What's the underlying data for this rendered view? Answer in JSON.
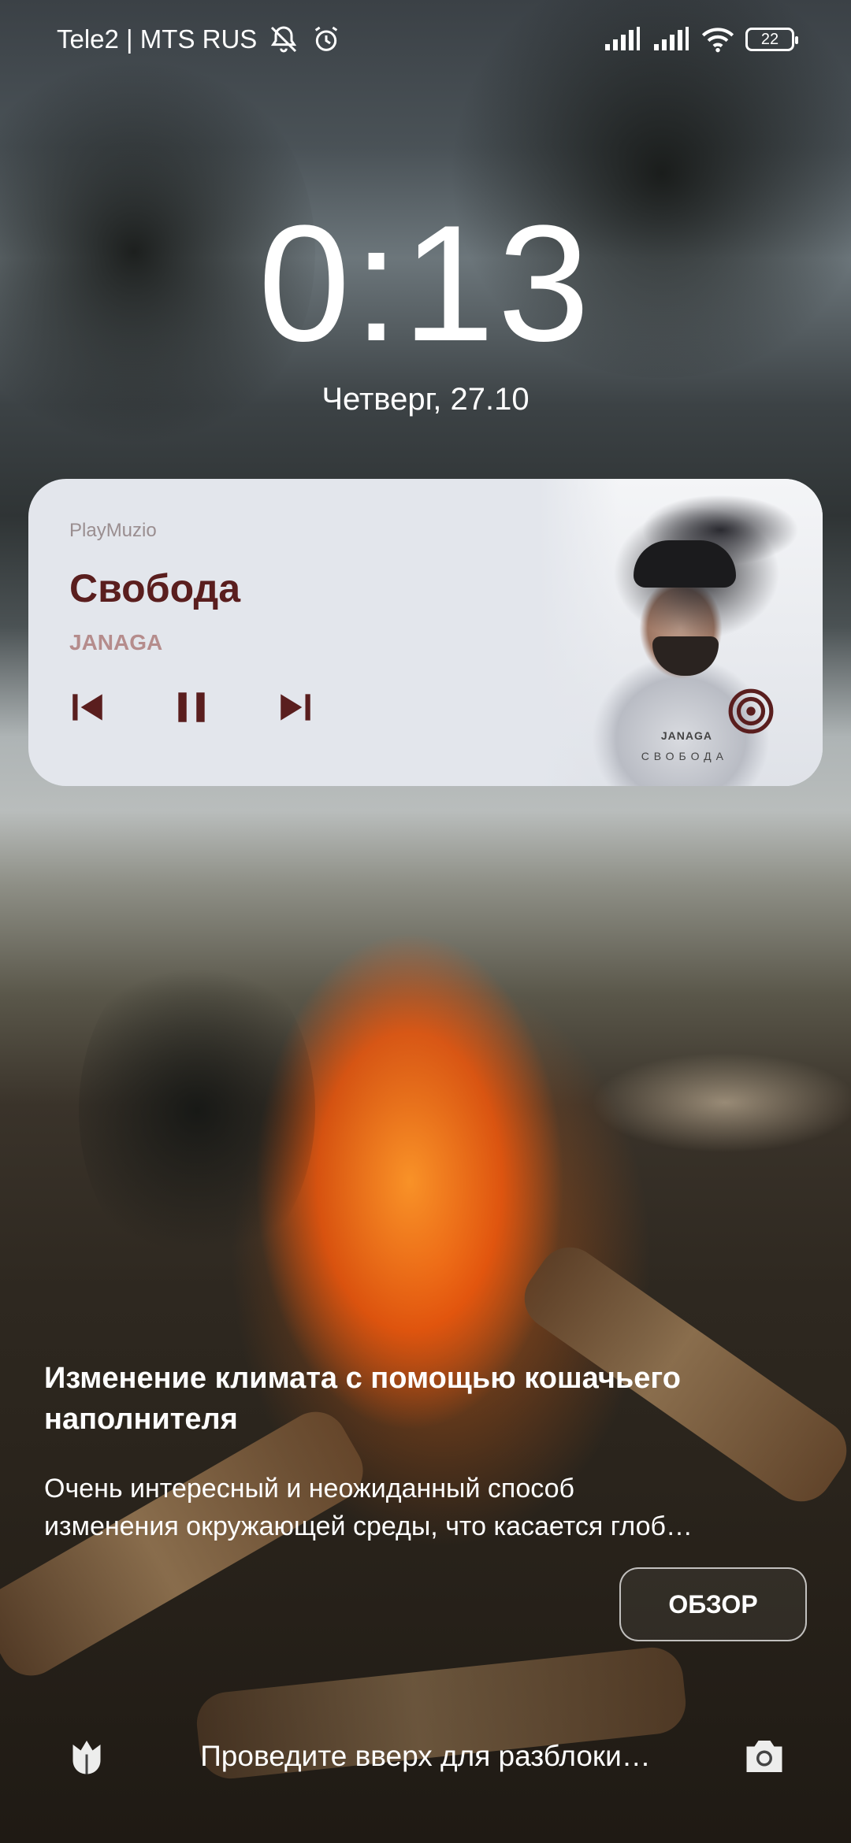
{
  "status_bar": {
    "carrier": "Tele2 | MTS RUS",
    "battery_level": "22",
    "icons": [
      "mute-bell-icon",
      "alarm-icon",
      "signal-icon",
      "signal-icon",
      "wifi-icon",
      "battery-icon"
    ]
  },
  "lock": {
    "time": "0:13",
    "date": "Четверг, 27.10"
  },
  "media": {
    "app_name": "PlayMuzio",
    "title": "Свобода",
    "artist": "JANAGA",
    "album_label": "JANAGA",
    "album_subtitle": "СВОБОДА",
    "accent_color": "#5a1e1e",
    "icons": [
      "previous-icon",
      "pause-icon",
      "next-icon",
      "cast-icon"
    ]
  },
  "article": {
    "title": "Изменение климата с помощью кошачьего наполнителя",
    "body_line1": "Очень интересный и неожиданный способ",
    "body_line2": "изменения окружающей среды, что касается глоб…",
    "button_label": "ОБЗОР"
  },
  "bottom": {
    "hint": "Проведите вверх для разблоки…",
    "icons": [
      "tulip-icon",
      "camera-icon"
    ]
  }
}
